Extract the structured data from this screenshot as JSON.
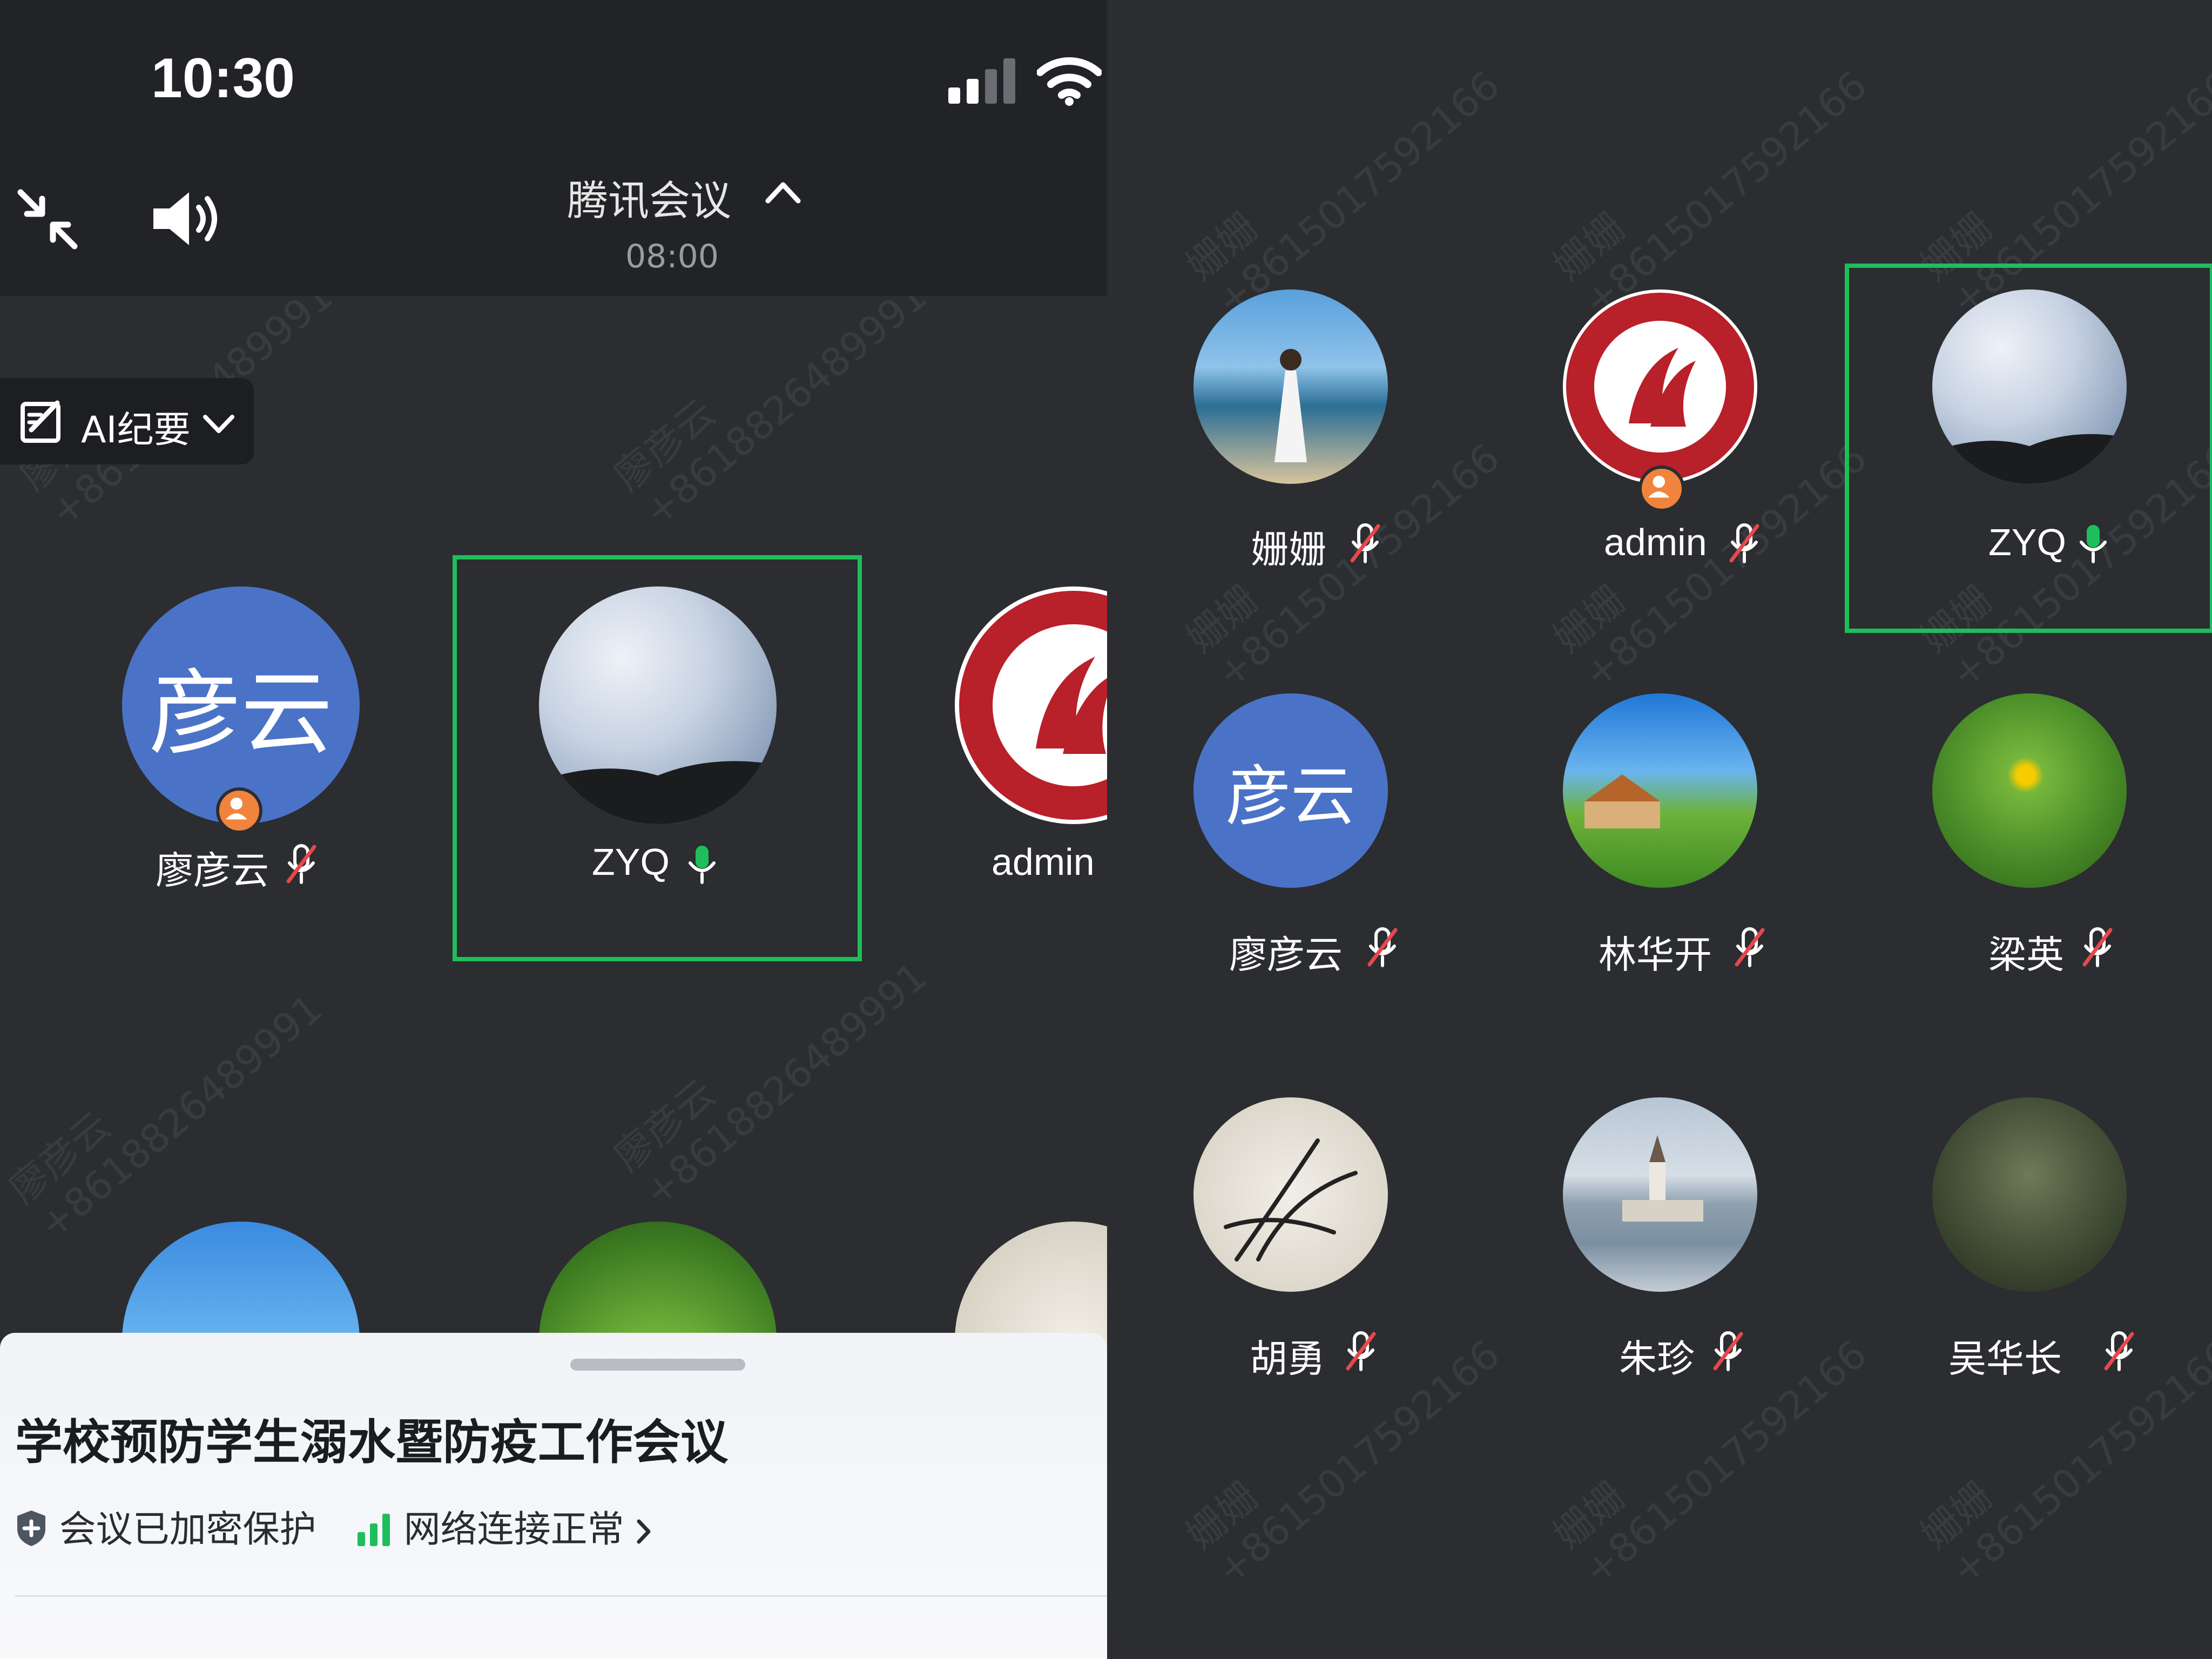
{
  "status_bar": {
    "time": "10:30"
  },
  "meeting_header": {
    "title": "腾讯会议",
    "duration": "08:00"
  },
  "ai_button": {
    "label": "AI纪要"
  },
  "watermarks": {
    "left": [
      "廖彦云",
      "+8618826489991"
    ],
    "right": [
      "姗姗",
      "+8615017592166"
    ]
  },
  "left_view": {
    "participants": [
      {
        "name": "廖彦云",
        "avatar_text": "彦云",
        "mic": "muted",
        "host_badge": true
      },
      {
        "name": "ZYQ",
        "avatar": "cloudy-sky-photo",
        "mic": "active",
        "speaking": true
      },
      {
        "name": "admin",
        "avatar": "college-seal-logo",
        "mic": "none"
      }
    ]
  },
  "right_view": {
    "participants": [
      {
        "name": "姗姗",
        "avatar": "beach-dancer-photo",
        "mic": "muted"
      },
      {
        "name": "admin",
        "avatar": "college-seal-logo",
        "mic": "muted",
        "host_badge": true
      },
      {
        "name": "ZYQ",
        "avatar": "cloudy-sky-photo",
        "mic": "active",
        "speaking": true
      },
      {
        "name": "廖彦云",
        "avatar_text": "彦云",
        "mic": "muted"
      },
      {
        "name": "林华开",
        "avatar": "house-landscape-photo",
        "mic": "muted"
      },
      {
        "name": "梁英",
        "avatar": "yellow-flower-photo",
        "mic": "muted"
      },
      {
        "name": "胡勇",
        "avatar": "orchid-ink-painting",
        "mic": "muted"
      },
      {
        "name": "朱珍",
        "avatar": "lake-church-photo",
        "mic": "muted"
      },
      {
        "name": "吴华长",
        "avatar": "bamboo-photo",
        "mic": "muted"
      }
    ]
  },
  "bottom_sheet": {
    "meeting_subject": "学校预防学生溺水暨防疫工作会议",
    "encryption_status": "会议已加密保护",
    "network_status": "网络连接正常"
  },
  "colors": {
    "background": "#2b2d31",
    "speaking_highlight": "#1ebe5a",
    "avatar_blue": "#4a73c7",
    "muted_red": "#e5484d",
    "host_badge": "#f0843c"
  }
}
